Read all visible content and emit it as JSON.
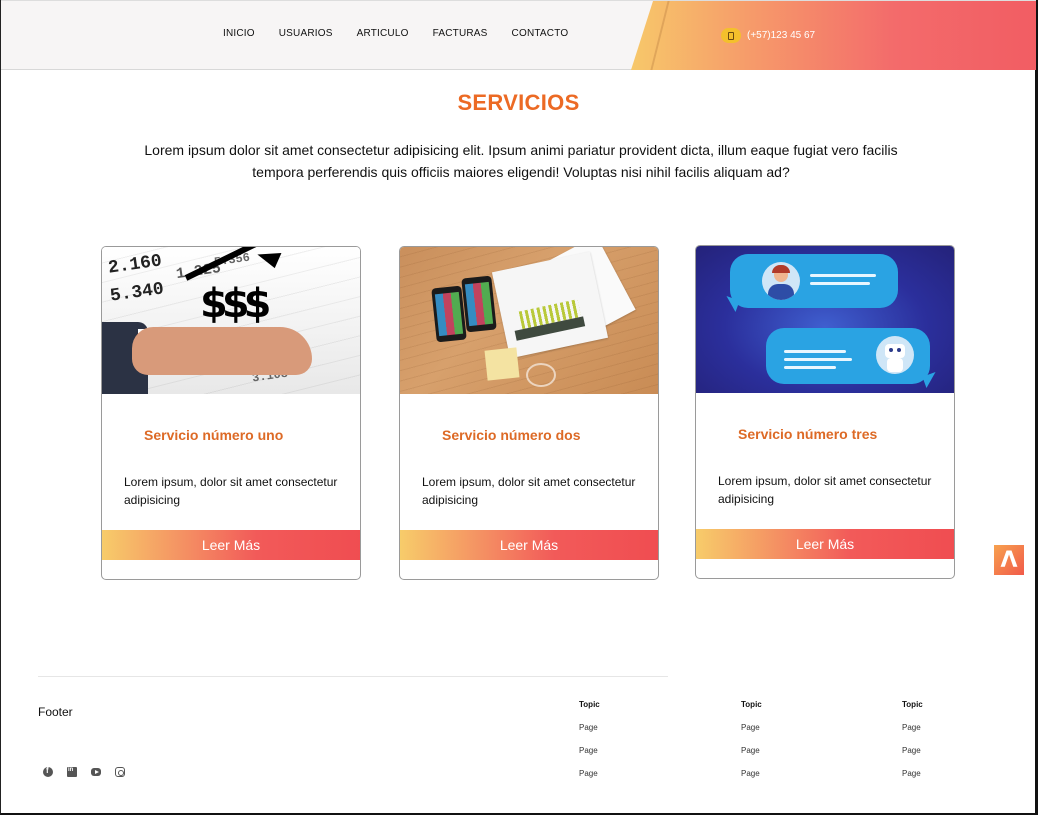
{
  "header": {
    "nav": [
      "INICIO",
      "USUARIOS",
      "ARTICULO",
      "FACTURAS",
      "CONTACTO"
    ],
    "phone": "(+57)123 45 67",
    "accent_gradient": [
      "#f7c86a",
      "#f25d63"
    ]
  },
  "services": {
    "title": "SERVICIOS",
    "intro": "Lorem ipsum dolor sit amet consectetur adipisicing elit. Ipsum animi pariatur provident dicta, illum eaque fugiat vero facilis tempora perferendis quis officiis maiores eligendi! Voluptas nisi nihil facilis aliquam ad?",
    "title_color": "#ec6a24",
    "cards": [
      {
        "title": "Servicio número uno",
        "text": "Lorem ipsum, dolor sit amet consectetur adipisicing",
        "button": "Leer Más",
        "image": "finance-image"
      },
      {
        "title": "Servicio número dos",
        "text": "Lorem ipsum, dolor sit amet consectetur adipisicing",
        "button": "Leer Más",
        "image": "desk-image"
      },
      {
        "title": "Servicio número tres",
        "text": "Lorem ipsum, dolor sit amet consectetur adipisicing",
        "button": "Leer Más",
        "image": "chat-image"
      }
    ]
  },
  "finance_image": {
    "numbers": [
      "2.160",
      "5.340",
      "1.225",
      "5.356",
      "3.108"
    ],
    "symbol": "$$$"
  },
  "scroll_top": {
    "icon": "chevron-up-icon"
  },
  "footer": {
    "brand": "Footer",
    "socials": [
      "facebook-icon",
      "linkedin-icon",
      "youtube-icon",
      "instagram-icon"
    ],
    "columns": [
      {
        "topic": "Topic",
        "pages": [
          "Page",
          "Page",
          "Page"
        ]
      },
      {
        "topic": "Topic",
        "pages": [
          "Page",
          "Page",
          "Page"
        ]
      },
      {
        "topic": "Topic",
        "pages": [
          "Page",
          "Page",
          "Page"
        ]
      }
    ]
  }
}
